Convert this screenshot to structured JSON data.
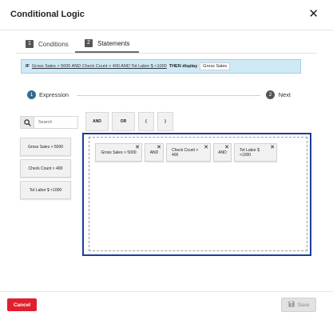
{
  "dialog": {
    "title": "Conditional Logic",
    "close_label": "✕"
  },
  "tabs": [
    {
      "number": "1",
      "label": "Conditions",
      "active": false
    },
    {
      "number": "2",
      "label": "Statements",
      "active": true
    }
  ],
  "banner": {
    "if_kw": "IF",
    "expression": "Gross Sales > 5000 AND Check Count > 400 AND Tot Labor $ <1000",
    "then_kw": "THEN display",
    "display_value": "Gross Sales"
  },
  "stepper": {
    "step1_num": "1",
    "step1_label": "Expression",
    "step2_num": "2",
    "step2_label": "Next"
  },
  "search": {
    "placeholder": "Search",
    "icon": "search-icon"
  },
  "operators": [
    "AND",
    "OR",
    "(",
    ")"
  ],
  "fields": [
    "Gross Sales > 5000",
    "Check Count > 400",
    "Tot Labor $ <1000"
  ],
  "expression_chips": [
    {
      "label": "Gross Sales > 5000",
      "remove": "✕"
    },
    {
      "label": "AND",
      "remove": "✕"
    },
    {
      "label": "Check Count > 400",
      "remove": "✕"
    },
    {
      "label": "AND",
      "remove": "✕"
    },
    {
      "label": "Tot Labor $ <1000",
      "remove": "✕"
    }
  ],
  "footer": {
    "cancel_label": "Cancel",
    "save_label": "Save",
    "save_icon": "save-icon"
  },
  "colors": {
    "cancel": "#e0202e",
    "dropzone_border": "#1a3d9a",
    "banner_bg": "#cfeaf6",
    "step_active": "#2d6e8e"
  }
}
